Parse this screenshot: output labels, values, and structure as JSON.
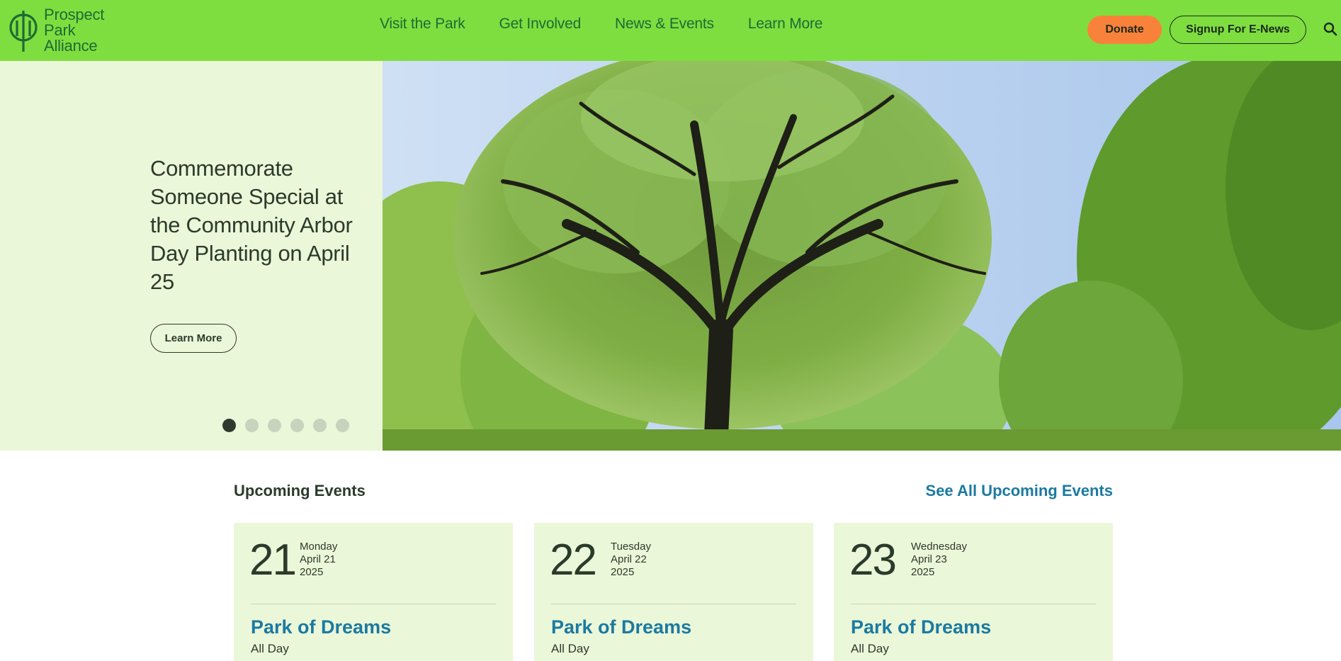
{
  "header": {
    "logo": {
      "line1": "Prospect",
      "line2": "Park",
      "line3": "Alliance"
    },
    "nav": [
      "Visit the Park",
      "Get Involved",
      "News & Events",
      "Learn More"
    ],
    "donate_label": "Donate",
    "signup_label": "Signup For E-News",
    "search_icon": "search-icon"
  },
  "hero": {
    "title": "Commemorate Someone Special at the Community Arbor Day Planting on April 25",
    "button_label": "Learn More",
    "slides_total": 6,
    "active_slide": 1
  },
  "events": {
    "heading": "Upcoming Events",
    "see_all_label": "See All Upcoming Events",
    "items": [
      {
        "day": "21",
        "weekday": "Monday",
        "month_day": "April 21",
        "year": "2025",
        "title": "Park of Dreams",
        "time": "All Day"
      },
      {
        "day": "22",
        "weekday": "Tuesday",
        "month_day": "April 22",
        "year": "2025",
        "title": "Park of Dreams",
        "time": "All Day"
      },
      {
        "day": "23",
        "weekday": "Wednesday",
        "month_day": "April 23",
        "year": "2025",
        "title": "Park of Dreams",
        "time": "All Day"
      }
    ]
  },
  "colors": {
    "header_bg": "#7ede40",
    "panel_bg": "#ebf7d9",
    "donate_bg": "#f9823a",
    "link_blue": "#1b7aa1",
    "logo_green": "#1f6b33"
  }
}
